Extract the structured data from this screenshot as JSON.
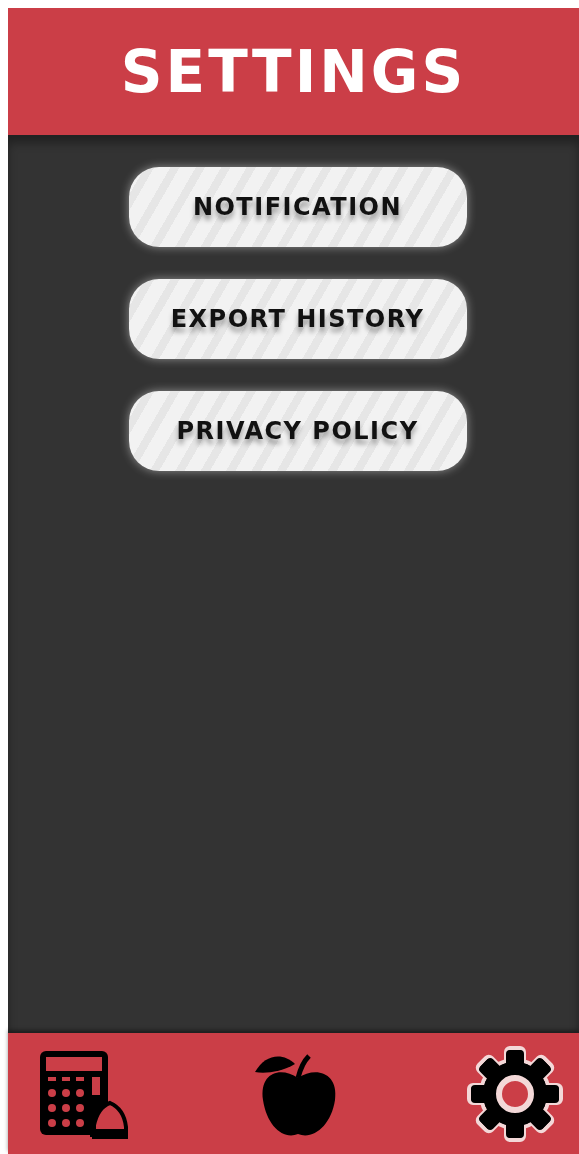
{
  "header": {
    "title": "SETTINGS"
  },
  "menu": [
    {
      "label": "NOTIFICATION"
    },
    {
      "label": "EXPORT HISTORY"
    },
    {
      "label": "PRIVACY POLICY"
    }
  ],
  "nav": [
    {
      "kind": "calculator",
      "selected": false
    },
    {
      "kind": "apple",
      "selected": false
    },
    {
      "kind": "gear",
      "selected": true
    }
  ]
}
